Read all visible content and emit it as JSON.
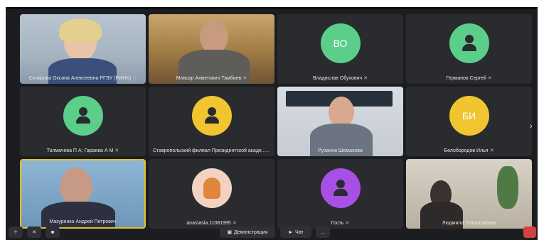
{
  "participants": [
    {
      "name": "Склярова Оксана Алексеевна РГЭУ (РИНХ)",
      "type": "video"
    },
    {
      "name": "Мовсар Ахметович Тамбиев",
      "type": "video"
    },
    {
      "name": "Владислав Обухович",
      "type": "avatar",
      "initials": "ВО",
      "color": "#5bcf8a"
    },
    {
      "name": "Германов Сергей",
      "type": "avatar",
      "icon": "person-icon",
      "color": "#5bcf8a"
    },
    {
      "name": "Толмачева П А; Гараева А М",
      "type": "avatar",
      "icon": "person-icon",
      "color": "#5bcf8a"
    },
    {
      "name": "Ставропольский филиал Президентской акаде...",
      "type": "avatar",
      "icon": "person-icon",
      "color": "#f0c530"
    },
    {
      "name": "Рузанна Шомахова",
      "type": "video"
    },
    {
      "name": "Белобородов Илья",
      "type": "avatar",
      "initials": "БИ",
      "color": "#f0c530"
    },
    {
      "name": "Мазуренко Андрей Петрович",
      "type": "video",
      "active": true
    },
    {
      "name": "anastasia.11081995",
      "type": "photo"
    },
    {
      "name": "Гость",
      "type": "avatar",
      "icon": "person-icon",
      "color": "#a84fe6"
    },
    {
      "name": "Людмила Тхабисимова",
      "type": "video"
    }
  ],
  "controls": {
    "demo_label": "Демонстрация",
    "chat_label": "Чат",
    "more_label": "..."
  },
  "colors": {
    "background": "#1c1d20",
    "tile": "#2a2b2f",
    "active_border": "#e2c12a"
  }
}
